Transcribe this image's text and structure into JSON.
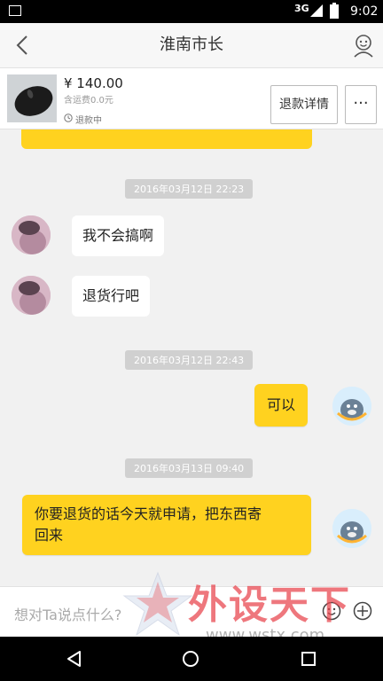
{
  "status_bar": {
    "network": "3G",
    "time": "9:02"
  },
  "header": {
    "title": "淮南市长"
  },
  "product": {
    "price": "¥ 140.00",
    "shipping": "含运费0.0元",
    "status": "退款中",
    "refund_details_label": "退款详情",
    "more_label": "···"
  },
  "messages": {
    "ts1": "2016年03月12日 22:23",
    "msg1": "我不会搞啊",
    "msg2": "退货行吧",
    "ts2": "2016年03月12日 22:43",
    "msg3": "可以",
    "ts3": "2016年03月13日 09:40",
    "msg4_line1": "你要退货的话今天就申请，把东西寄",
    "msg4_line2": "回来"
  },
  "input": {
    "placeholder": "想对Ta说点什么?"
  },
  "watermark": {
    "brand": "外设天下",
    "url": "www.wstx.com"
  },
  "colors": {
    "accent": "#ffd21f",
    "watermark": "#e8444c"
  }
}
